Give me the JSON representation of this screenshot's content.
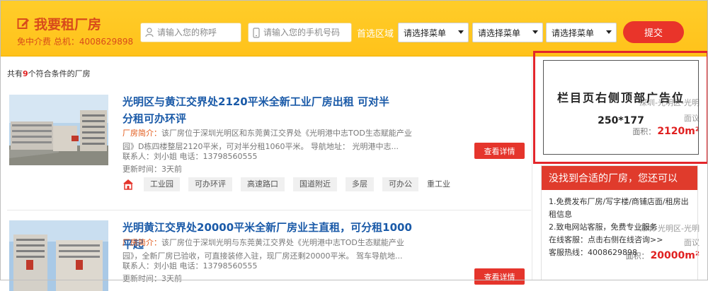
{
  "header": {
    "title": "我要租厂房",
    "subtitle": "免中介费 总机：4008629898",
    "name_placeholder": "请输入您的称呼",
    "phone_placeholder": "请输入您的手机号码",
    "area_label": "首选区域",
    "selects": [
      "请选择菜单",
      "请选择菜单",
      "请选择菜单"
    ],
    "submit_label": "提交"
  },
  "results": {
    "prefix": "共有",
    "count": "9",
    "suffix": "个符合条件的厂房"
  },
  "listings": [
    {
      "title": "光明区与黄江交界处2120平米全新工业厂房出租 可对半分租可办环评",
      "desc_label": "厂房简介：",
      "desc": "该厂房位于深圳光明区和东莞黄江交界处《光明港中志TOD生态赋能产业园》D栋四楼整层2120平米，可对半分租1060平米。 导航地址： 光明港中志...",
      "contact": "联系人：刘小姐 电话：13798560555",
      "updated": "更新时间：3天前",
      "tags": [
        "工业园",
        "可办环评",
        "高速路口",
        "国道附近",
        "多层",
        "可办公",
        "重工业"
      ],
      "location": "深圳-光明区-光明",
      "price": "面议",
      "area_label": "面积：",
      "area_value": "2120m²",
      "button": "查看详情"
    },
    {
      "title": "光明黄江交界处20000平米全新厂房业主直租，可分租1000平起",
      "desc_label": "厂房简介：",
      "desc": "该厂房位于深圳光明与东莞黄江交界处《光明港中志TOD生态赋能产业园》，全新厂房已验收，可直接装修入驻，现厂房还剩20000平米。 驾车导航地...",
      "contact": "联系人：刘小姐 电话：13798560555",
      "updated": "更新时间：3天前",
      "location": "深圳-光明区-光明",
      "price": "面议",
      "area_label": "面积：",
      "area_value": "20000m²",
      "button": "查看详情"
    }
  ],
  "sidebar": {
    "ad_title": "栏目页右侧顶部广告位",
    "ad_size": "250*177",
    "help_title": "没找到合适的厂房，您还可以",
    "help_lines": [
      "1.免费发布厂房/写字楼/商铺店面/租房出租信息",
      "2.致电网站客服，免费专业服务",
      "在线客服：点击右侧在线咨询>>",
      "客服热线：4008629898"
    ]
  },
  "colors": {
    "header_bg": "#ffc421",
    "accent_red": "#e5352c",
    "title_blue": "#1a5aa8"
  }
}
